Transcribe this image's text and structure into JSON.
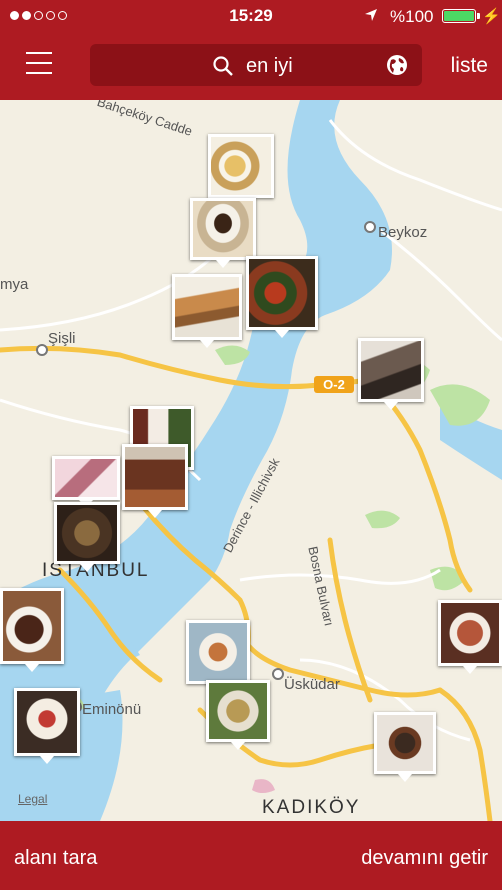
{
  "status_bar": {
    "time": "15:29",
    "battery_percent": "%100",
    "signal_filled": 2,
    "signal_total": 5
  },
  "nav": {
    "search_text": "en iyi",
    "list_label": "liste",
    "menu_icon": "hamburger-icon",
    "search_icon": "search-icon",
    "globe_icon": "globe-icon"
  },
  "map": {
    "labels": {
      "cadde": "Bahçeköy Cadde",
      "beykoz": "Beykoz",
      "umya": "mya",
      "sisli": "Şişli",
      "istanbul": "ISTANBUL",
      "derince": "Derince - Illichivsk",
      "bosna": "Bosna Bulvarı",
      "uskudar": "Üsküdar",
      "eminonu": "Eminönü",
      "kadikoy": "KADIKÖY",
      "highway": "O-2",
      "legal": "Legal"
    },
    "colors": {
      "water": "#a6d6f0",
      "land": "#f3efe3",
      "park": "#bde3a4",
      "road": "#f6c445",
      "brand": "#ae1b22"
    }
  },
  "bottom_bar": {
    "scan_label": "alanı tara",
    "more_label": "devamını getir"
  }
}
